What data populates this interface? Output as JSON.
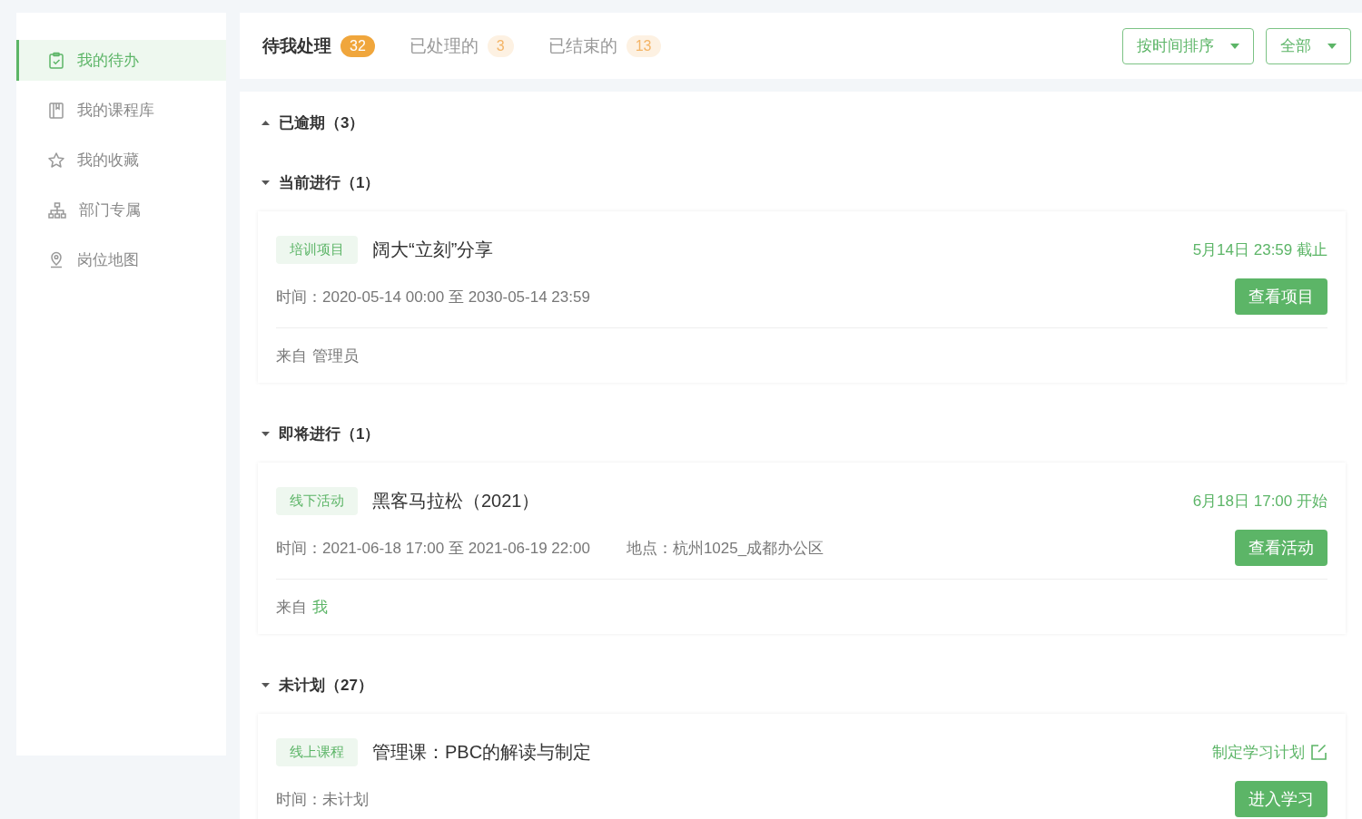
{
  "sidebar": {
    "items": [
      {
        "label": "我的待办",
        "selected": true
      },
      {
        "label": "我的课程库",
        "selected": false
      },
      {
        "label": "我的收藏",
        "selected": false
      },
      {
        "label": "部门专属",
        "selected": false
      },
      {
        "label": "岗位地图",
        "selected": false
      }
    ]
  },
  "tabs": [
    {
      "label": "待我处理",
      "count": "32",
      "selected": true
    },
    {
      "label": "已处理的",
      "count": "3",
      "selected": false
    },
    {
      "label": "已结束的",
      "count": "13",
      "selected": false
    }
  ],
  "filters": [
    {
      "label": "按时间排序"
    },
    {
      "label": "全部"
    }
  ],
  "sections": [
    {
      "title": "已逾期（3）",
      "expanded": false
    },
    {
      "title": "当前进行（1）",
      "expanded": true,
      "cards": [
        {
          "tag": "培训项目",
          "title": "阔大“立刻”分享",
          "status": "5月14日 23:59 截止",
          "kind": "status",
          "time": "时间：2020-05-14 00:00 至 2030-05-14 23:59",
          "button": "查看项目",
          "from_label": "来自",
          "from": "管理员",
          "from_is_me": false
        }
      ]
    },
    {
      "title": "即将进行（1）",
      "expanded": true,
      "cards": [
        {
          "tag": "线下活动",
          "title": "黑客马拉松（2021）",
          "status": "6月18日 17:00 开始",
          "kind": "status",
          "time": "时间：2021-06-18 17:00 至 2021-06-19 22:00",
          "location": "地点：杭州1025_成都办公区",
          "button": "查看活动",
          "from_label": "来自",
          "from": "我",
          "from_is_me": true
        }
      ]
    },
    {
      "title": "未计划（27）",
      "expanded": true,
      "cards": [
        {
          "tag": "线上课程",
          "title": "管理课：PBC的解读与制定",
          "status": "制定学习计划",
          "kind": "link",
          "time": "时间：未计划",
          "button": "进入学习"
        }
      ]
    }
  ]
}
